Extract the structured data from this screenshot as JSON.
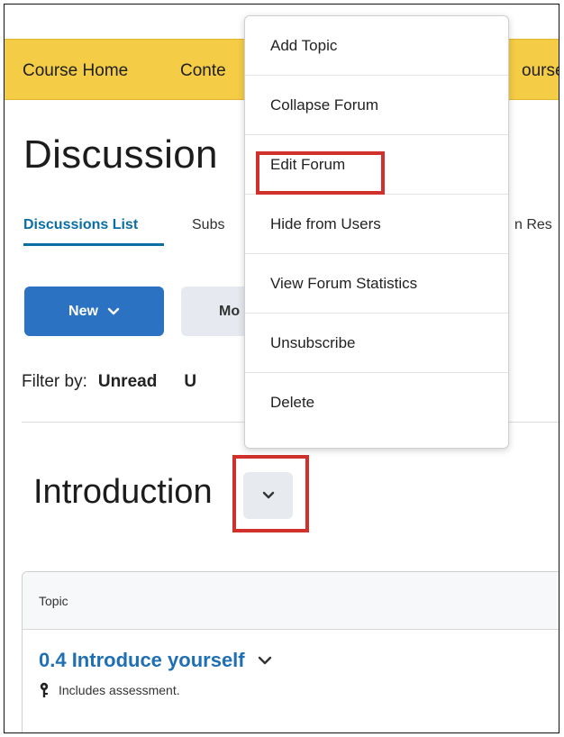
{
  "navbar": {
    "items": [
      "Course Home",
      "Conte",
      "ourse"
    ]
  },
  "page": {
    "title": "Discussion"
  },
  "tabs": {
    "items": [
      "Discussions List",
      "Subs",
      "n Res"
    ],
    "active_index": 0
  },
  "toolbar": {
    "new_label": "New",
    "more_label": "Mo"
  },
  "filter": {
    "label": "Filter by:",
    "options": [
      "Unread",
      "U"
    ]
  },
  "forum": {
    "title": "Introduction"
  },
  "table": {
    "header": "Topic",
    "topic_title": "0.4 Introduce yourself",
    "assessment_note": "Includes assessment."
  },
  "context_menu": {
    "items": [
      "Add Topic",
      "Collapse Forum",
      "Edit Forum",
      "Hide from Users",
      "View Forum Statistics",
      "Unsubscribe",
      "Delete"
    ]
  },
  "colors": {
    "navbar_bg": "#f4cc45",
    "primary_button": "#2b72c3",
    "link_blue": "#1f6fb5",
    "highlight_red": "#d0312d"
  },
  "icons": {
    "new_dropdown": "chevron-down-icon",
    "forum_menu": "chevron-down-icon",
    "topic_menu": "chevron-down-icon",
    "assessment": "key-icon"
  }
}
